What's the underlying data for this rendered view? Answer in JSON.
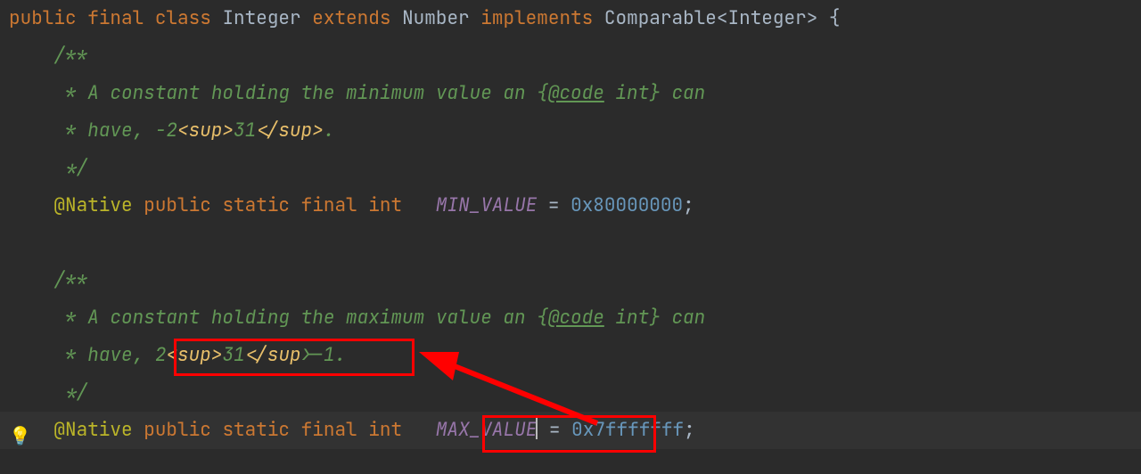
{
  "code": {
    "l1": {
      "kw_public": "public",
      "kw_final": "final",
      "kw_class": "class",
      "name": "Integer",
      "kw_extends": "extends",
      "super": "Number",
      "kw_implements": "implements",
      "iface": "Comparable",
      "lt": "<",
      "param": "Integer",
      "gt": ">",
      "brace": " {"
    },
    "l2": {
      "open": "/**"
    },
    "l3": {
      "star": " * ",
      "t1": "A constant holding the minimum value an ",
      "brace_open": "{",
      "tag": "@code",
      "tag_text": " int",
      "brace_close": "}",
      "t2": " can"
    },
    "l4": {
      "star": " * ",
      "t1": "have, -2",
      "sup_open": "<sup>",
      "exp": "31",
      "sup_close": "</sup>",
      "period": "."
    },
    "l5": {
      "close": " */"
    },
    "l6": {
      "ann": "@Native",
      "kw_public": "public",
      "kw_static": "static",
      "kw_final": "final",
      "kw_int": "int",
      "name": "MIN_VALUE",
      "eq": " = ",
      "val": "0x80000000",
      "semi": ";"
    },
    "l7": {
      "blank": ""
    },
    "l8": {
      "open": "/**"
    },
    "l9": {
      "star": " * ",
      "t1": "A constant holding the maximum value an ",
      "brace_open": "{",
      "tag": "@code",
      "tag_text": " int",
      "brace_close": "}",
      "t2": " can"
    },
    "l10": {
      "star": " * ",
      "t1": "have, ",
      "boxed": "2<sup>31</sup>-1.",
      "two": "2",
      "sup_open": "<sup>",
      "exp": "31",
      "sup_close": "</sup>",
      "rest": "-1."
    },
    "l11": {
      "close": " */"
    },
    "l12": {
      "ann": "@Native",
      "kw_public": "public",
      "kw_static": "static",
      "kw_final": "final",
      "kw_int": "int",
      "name": "MAX_VALUE",
      "eq": " = ",
      "val": "0x7fffffff",
      "semi": ";"
    }
  },
  "indent": {
    "c1": "",
    "c2": "    ",
    "c3": "     "
  },
  "icons": {
    "bulb": "💡"
  }
}
